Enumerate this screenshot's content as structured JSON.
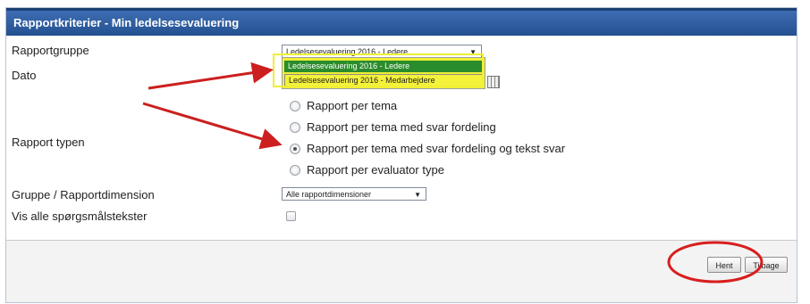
{
  "header": {
    "title": "Rapportkriterier - Min ledelsesevaluering"
  },
  "form": {
    "report_group_label": "Rapportgruppe",
    "report_group_value": "Ledelsesevaluering 2016 - Ledere",
    "report_group_options": [
      "Ledelsesevaluering 2016 - Ledere",
      "Ledelsesevaluering 2016 - Medarbejdere"
    ],
    "date_label": "Dato",
    "report_type_label": "Rapport typen",
    "report_types": [
      {
        "label": "Rapport per tema",
        "checked": false
      },
      {
        "label": "Rapport per tema med svar fordeling",
        "checked": false
      },
      {
        "label": "Rapport per tema med svar fordeling og tekst svar",
        "checked": true
      },
      {
        "label": "Rapport per evaluator type",
        "checked": false
      }
    ],
    "dimension_label": "Gruppe / Rapportdimension",
    "dimension_value": "Alle rapportdimensioner",
    "show_all_label": "Vis alle spørgsmålstekster",
    "show_all_checked": false
  },
  "footer": {
    "fetch_label": "Hent",
    "back_label": "Tilbage"
  },
  "annotations": {
    "arrow_color": "#cc1f1f",
    "circle_color": "#d81e1e",
    "highlight_color": "#f1ef35"
  }
}
